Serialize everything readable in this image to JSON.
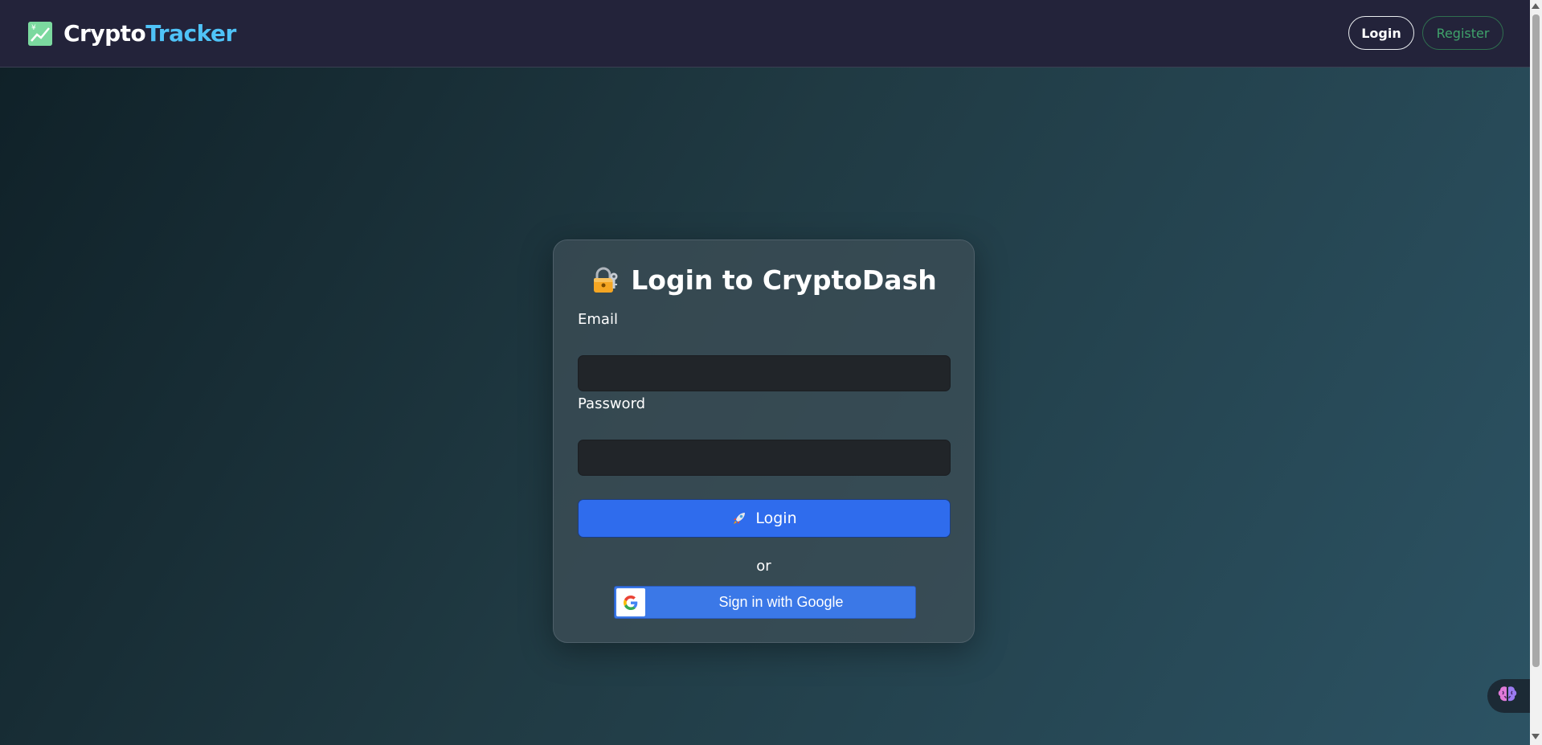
{
  "navbar": {
    "brand_part1": "Crypto",
    "brand_part2": "Tracker",
    "brand_icon": "chart-increasing-icon",
    "login_label": "Login",
    "register_label": "Register"
  },
  "login_card": {
    "title": "Login to CryptoDash",
    "title_icon": "locked-with-key-icon",
    "email_label": "Email",
    "email_value": "",
    "password_label": "Password",
    "password_value": "",
    "submit_icon": "rocket-icon",
    "submit_label": "Login",
    "divider_text": "or",
    "google_icon": "google-logo-icon",
    "google_label": "Sign in with Google"
  },
  "floating_widget": {
    "icon": "brain-icon"
  },
  "colors": {
    "navbar_bg": "#23233a",
    "brand_accent": "#4fc3f7",
    "primary_button": "#2f6ced",
    "google_button": "#3b78e7",
    "register_accent": "#3fa36b"
  }
}
